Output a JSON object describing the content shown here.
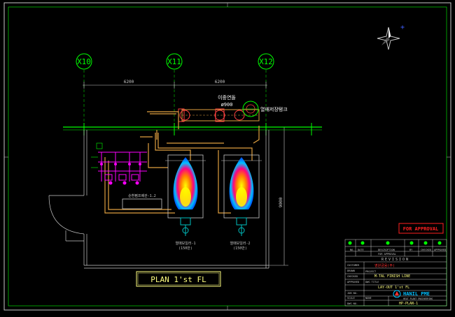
{
  "grid_labels": {
    "x10": "X10",
    "x11": "X11",
    "x12": "X12"
  },
  "dimensions": {
    "d1": "6200",
    "d2": "6200",
    "vertical": "9000"
  },
  "annotations": {
    "stack_name": "이중연돌",
    "stack_size": "ø900",
    "tank_label": "열매저장탱크",
    "panel_label": "순환펌프배관-1.2",
    "heater1": "열매보일러-1",
    "heater1_cap": "(150만)",
    "heater2": "열매보일러-2",
    "heater2_cap": "(150만)"
  },
  "plan_title": "PLAN 1'st FL",
  "stamp": "FOR APPROVAL",
  "title_block": {
    "revision_header": "REVISION",
    "rev_cols": [
      "NO.",
      "DATE",
      "DESCRIPTION",
      "BY",
      "CHECKED",
      "APPROVED"
    ],
    "rev_row1": "FOR APPROVAL",
    "rows": {
      "drawn_lbl": "DRAWN",
      "checked_lbl": "CHECKED",
      "approved_lbl": "APPROVED",
      "customer_lbl": "CUSTOMER",
      "customer_val": "영원금융(주)",
      "project_lbl": "PROJECT",
      "project_val": "M-TAL FINISH LINE",
      "title_lbl": "DWG TITLE",
      "title_val": "LAY-OUT 1'st FL",
      "job_lbl": "JOB NO.",
      "scale_lbl": "SCALE",
      "scale_val": "NONE",
      "dwg_lbl": "DWG NO.",
      "dwg_val": "HP-PLAN-1"
    },
    "company": "HANIL PME",
    "company_sub": "HEAT PLANT ENGINEERING"
  },
  "colors": {
    "grid_green": "#00ff00",
    "pipe_orange": "#e0a040",
    "pipe_magenta": "#ff00ff",
    "wall_white": "#c8c8c8",
    "stamp_red": "#ff2020",
    "title_yellow": "#ffff80"
  }
}
